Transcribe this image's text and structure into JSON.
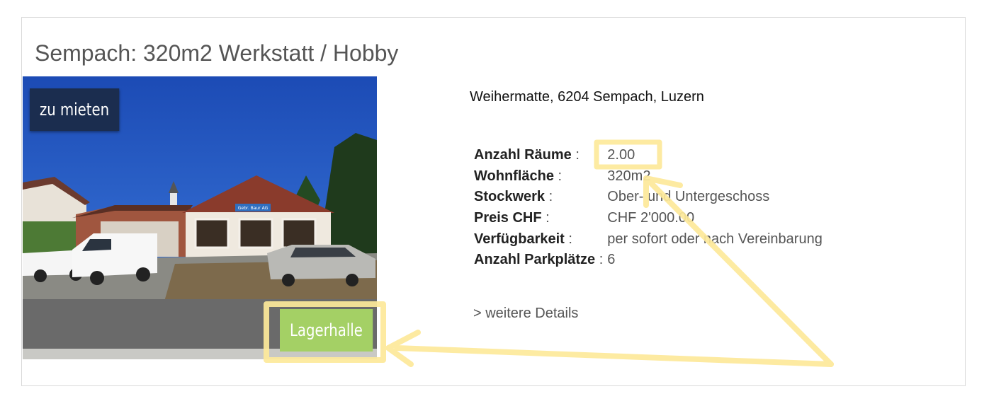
{
  "listing": {
    "title": "Sempach: 320m2 Werkstatt / Hobby",
    "badge_status": "zu mieten",
    "badge_type": "Lagerhalle",
    "address": "Weihermatte, 6204 Sempach, Luzern",
    "facts": [
      {
        "label": "Anzahl Räume",
        "value": "2.00"
      },
      {
        "label": "Wohnfläche",
        "value": "320m2"
      },
      {
        "label": "Stockwerk",
        "value": "Ober- und Untergeschoss"
      },
      {
        "label": "Preis CHF",
        "value": "CHF 2'000.00"
      },
      {
        "label": "Verfügbarkeit",
        "value": "per sofort oder nach Vereinbarung"
      },
      {
        "label": "Anzahl Parkplätze",
        "value": "6"
      }
    ],
    "separator": ":",
    "details_link": "> weitere Details",
    "photo_sign": "Gebr. Baur AG"
  },
  "colors": {
    "badge_status_bg": "#1b2d4f",
    "badge_type_bg": "#a4d065",
    "annotation": "#fde99a"
  }
}
